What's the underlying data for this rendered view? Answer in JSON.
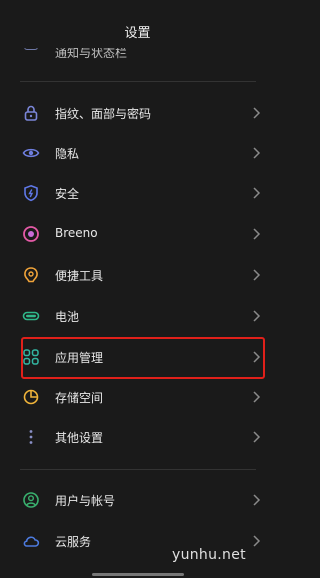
{
  "header": {
    "title": "设置"
  },
  "cut_item": {
    "label": "通知与状态栏"
  },
  "items": [
    {
      "label": "指纹、面部与密码",
      "icon": "lock-icon",
      "color": "#7b86d8"
    },
    {
      "label": "隐私",
      "icon": "eye-icon",
      "color": "#6f7fe0"
    },
    {
      "label": "安全",
      "icon": "shield-icon",
      "color": "#5f78e8"
    },
    {
      "label": "Breeno",
      "icon": "breeno-icon",
      "color": "#e45aa6"
    },
    {
      "label": "便捷工具",
      "icon": "tools-icon",
      "color": "#f0a43a"
    },
    {
      "label": "电池",
      "icon": "battery-icon",
      "color": "#2fb88a"
    },
    {
      "label": "应用管理",
      "icon": "apps-grid-icon",
      "color": "#33b6a2"
    },
    {
      "label": "存储空间",
      "icon": "storage-pie-icon",
      "color": "#f0b43a"
    },
    {
      "label": "其他设置",
      "icon": "more-dots-icon",
      "color": "#8a90c8"
    },
    {
      "label": "用户与帐号",
      "icon": "user-icon",
      "color": "#39b06e"
    },
    {
      "label": "云服务",
      "icon": "cloud-icon",
      "color": "#4d7be0"
    }
  ],
  "highlight_color": "#e0201a",
  "watermark": "yunhu.net"
}
